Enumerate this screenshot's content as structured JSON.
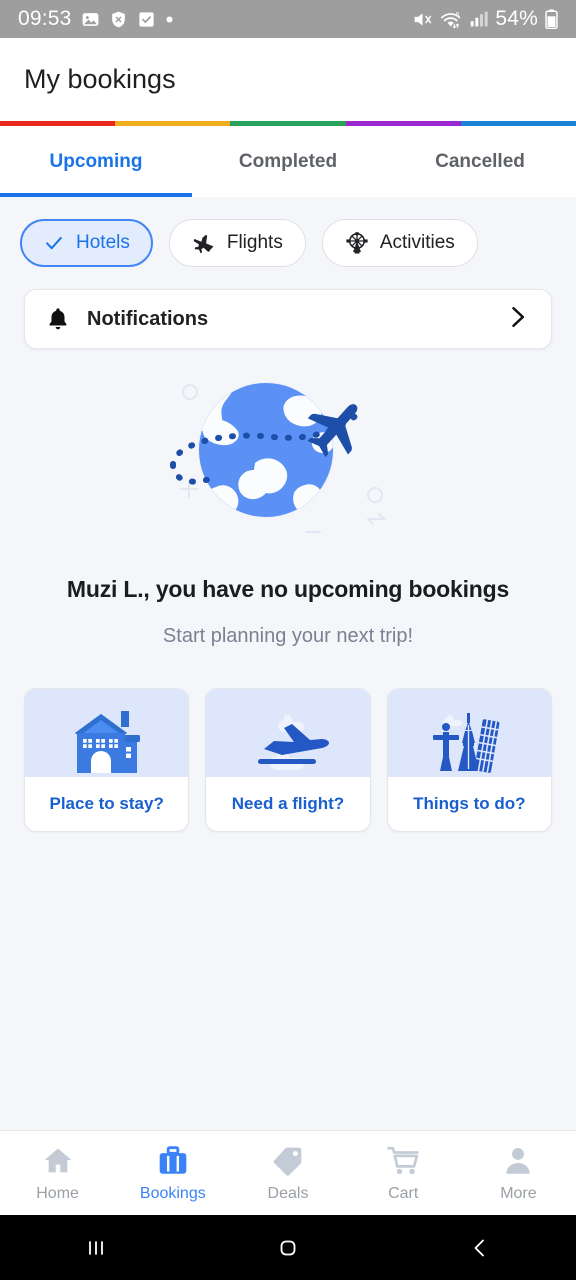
{
  "status_bar": {
    "time": "09:53",
    "battery_text": "54%",
    "left_icons": [
      "photos-icon",
      "shield-x-icon",
      "checkbox-checked-icon",
      "dot-icon"
    ],
    "right_icons": [
      "mute-icon",
      "wifi-6-icon",
      "cellular-signal-icon",
      "battery-icon"
    ]
  },
  "header": {
    "title": "My bookings"
  },
  "color_stripe": {
    "colors": [
      "#e8291c",
      "#f0ad1e",
      "#27a35b",
      "#9c27d0",
      "#1a85d6"
    ]
  },
  "tabs": [
    {
      "label": "Upcoming",
      "active": true
    },
    {
      "label": "Completed",
      "active": false
    },
    {
      "label": "Cancelled",
      "active": false
    }
  ],
  "chips": [
    {
      "label": "Hotels",
      "icon": "check-icon",
      "selected": true
    },
    {
      "label": "Flights",
      "icon": "airplane-icon",
      "selected": false
    },
    {
      "label": "Activities",
      "icon": "ferris-wheel-icon",
      "selected": false
    }
  ],
  "notifications": {
    "label": "Notifications",
    "bell_icon": "bell-icon",
    "chevron_icon": "chevron-right-icon"
  },
  "empty_state": {
    "illustration": "globe-with-airplane-illustration",
    "title": "Muzi L., you have no upcoming bookings",
    "subtitle": "Start planning your next trip!"
  },
  "action_cards": [
    {
      "label": "Place to stay?",
      "art": "house-illustration"
    },
    {
      "label": "Need a flight?",
      "art": "airplane-clouds-illustration"
    },
    {
      "label": "Things to do?",
      "art": "landmarks-illustration"
    }
  ],
  "bottom_nav": [
    {
      "label": "Home",
      "icon": "home-icon",
      "active": false
    },
    {
      "label": "Bookings",
      "icon": "briefcase-icon",
      "active": true
    },
    {
      "label": "Deals",
      "icon": "tag-icon",
      "active": false
    },
    {
      "label": "Cart",
      "icon": "shopping-cart-icon",
      "active": false
    },
    {
      "label": "More",
      "icon": "person-icon",
      "active": false
    }
  ],
  "android_nav": [
    {
      "icon": "recents-icon"
    },
    {
      "icon": "home-square-icon"
    },
    {
      "icon": "back-chevron-icon"
    }
  ],
  "colors": {
    "accent": "#1a73e8",
    "chip_selected_bg": "#e3ecfd",
    "page_bg": "#f4f6fa",
    "card_art_bg": "#dde6fa",
    "illustration_blue": "#5b91f5",
    "illustration_navy": "#1d4ea8",
    "status_bar_bg": "#9e9e9e"
  }
}
